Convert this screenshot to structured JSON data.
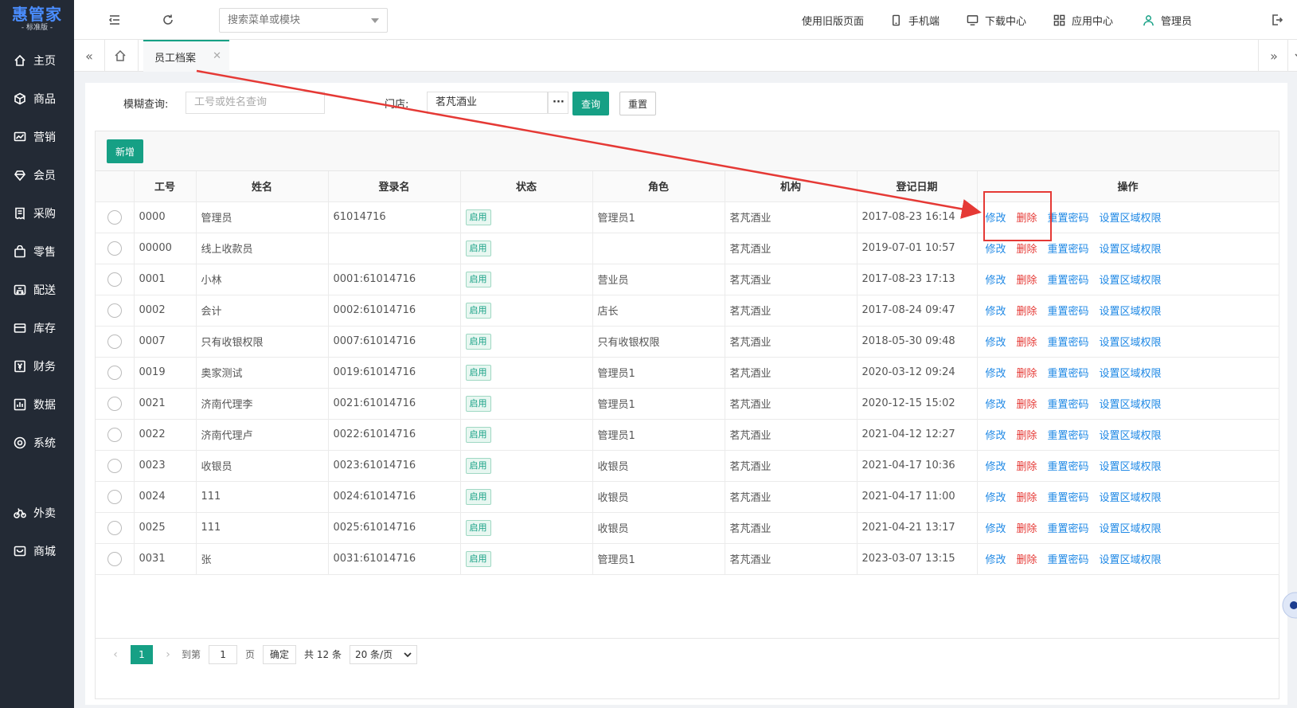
{
  "brand": {
    "name": "惠管家",
    "edition": "标准版"
  },
  "nav": [
    {
      "label": "主页",
      "icon": "home-icon"
    },
    {
      "label": "商品",
      "icon": "cube-icon"
    },
    {
      "label": "营销",
      "icon": "chart-icon"
    },
    {
      "label": "会员",
      "icon": "diamond-icon"
    },
    {
      "label": "采购",
      "icon": "receipt-icon"
    },
    {
      "label": "零售",
      "icon": "bag-icon"
    },
    {
      "label": "配送",
      "icon": "truck-icon"
    },
    {
      "label": "库存",
      "icon": "box-icon"
    },
    {
      "label": "财务",
      "icon": "yen-icon"
    },
    {
      "label": "数据",
      "icon": "bar-chart-icon"
    },
    {
      "label": "系统",
      "icon": "settings-icon"
    },
    {
      "label": "外卖",
      "icon": "bike-icon"
    },
    {
      "label": "商城",
      "icon": "store-icon"
    }
  ],
  "topbar": {
    "search_placeholder": "搜索菜单或模块",
    "old_version": "使用旧版页面",
    "mobile": "手机端",
    "download": "下载中心",
    "apps": "应用中心",
    "user": "管理员"
  },
  "tabs": {
    "active": "员工档案"
  },
  "filter": {
    "fuzzy_label": "模糊查询:",
    "fuzzy_placeholder": "工号或姓名查询",
    "store_label": "门店:",
    "store_value": "茗芃酒业",
    "more": "···",
    "query": "查询",
    "reset": "重置"
  },
  "toolbar": {
    "add": "新增"
  },
  "table": {
    "headers": [
      "工号",
      "姓名",
      "登录名",
      "状态",
      "角色",
      "机构",
      "登记日期",
      "操作"
    ],
    "rows": [
      [
        "0000",
        "管理员",
        "61014716",
        "启用",
        "管理员1",
        "茗芃酒业",
        "2017-08-23 16:14"
      ],
      [
        "00000",
        "线上收款员",
        "",
        "启用",
        "",
        "茗芃酒业",
        "2019-07-01 10:57"
      ],
      [
        "0001",
        "小林",
        "0001:61014716",
        "启用",
        "营业员",
        "茗芃酒业",
        "2017-08-23 17:13"
      ],
      [
        "0002",
        "会计",
        "0002:61014716",
        "启用",
        "店长",
        "茗芃酒业",
        "2017-08-24 09:47"
      ],
      [
        "0007",
        "只有收银权限",
        "0007:61014716",
        "启用",
        "只有收银权限",
        "茗芃酒业",
        "2018-05-30 09:48"
      ],
      [
        "0019",
        "奥家测试",
        "0019:61014716",
        "启用",
        "管理员1",
        "茗芃酒业",
        "2020-03-12 09:24"
      ],
      [
        "0021",
        "济南代理李",
        "0021:61014716",
        "启用",
        "管理员1",
        "茗芃酒业",
        "2020-12-15 15:02"
      ],
      [
        "0022",
        "济南代理卢",
        "0022:61014716",
        "启用",
        "管理员1",
        "茗芃酒业",
        "2021-04-12 12:27"
      ],
      [
        "0023",
        "收银员",
        "0023:61014716",
        "启用",
        "收银员",
        "茗芃酒业",
        "2021-04-17 10:36"
      ],
      [
        "0024",
        "111",
        "0024:61014716",
        "启用",
        "收银员",
        "茗芃酒业",
        "2021-04-17 11:00"
      ],
      [
        "0025",
        "111",
        "0025:61014716",
        "启用",
        "收银员",
        "茗芃酒业",
        "2021-04-21 13:17"
      ],
      [
        "0031",
        "张",
        "0031:61014716",
        "启用",
        "管理员1",
        "茗芃酒业",
        "2023-03-07 13:15"
      ]
    ],
    "actions": [
      "修改",
      "删除",
      "重置密码",
      "设置区域权限"
    ]
  },
  "pager": {
    "current": "1",
    "goto_label": "到第",
    "goto_value": "1",
    "page_unit": "页",
    "confirm": "确定",
    "total": "共 12 条",
    "page_size": "20 条/页"
  },
  "colors": {
    "accent": "#16a085",
    "sidebar": "#232a35",
    "link": "#1e88e5",
    "danger": "#e53935"
  }
}
